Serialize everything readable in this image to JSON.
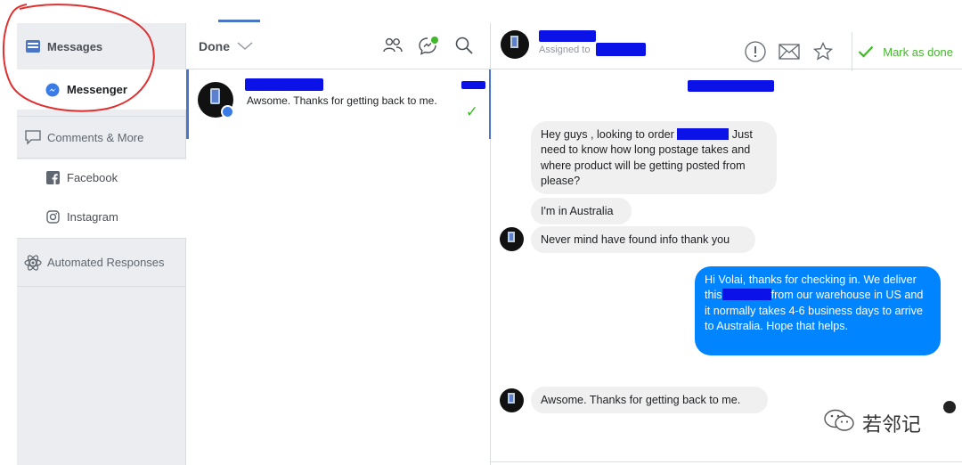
{
  "sidebar": {
    "messages": "Messages",
    "messenger": "Messenger",
    "comments": "Comments & More",
    "facebook": "Facebook",
    "instagram": "Instagram",
    "automated": "Automated Responses"
  },
  "list": {
    "filter_label": "Done",
    "rows": [
      {
        "snippet": "Awsome. Thanks for getting back to me."
      }
    ]
  },
  "chat": {
    "assigned_label": "Assigned to",
    "mark_done_label": "Mark as done",
    "messages": [
      {
        "side": "in",
        "text_a": "Hey guys , looking to order ",
        "text_b": " Just need to know how long postage takes and where product will be getting posted from please?"
      },
      {
        "side": "in",
        "text": "I'm in Australia"
      },
      {
        "side": "in",
        "text": "Never mind have found info thank you"
      },
      {
        "side": "out",
        "text_a": "Hi Volai, thanks for checking in. We deliver this",
        "text_b": "from our warehouse in US and it normally takes 4-6 business days to arrive to Australia. Hope that helps."
      },
      {
        "side": "in",
        "text": "Awsome. Thanks for getting back to me."
      }
    ]
  },
  "watermark": {
    "text": "若邻记"
  },
  "colors": {
    "accent": "#4a76c5",
    "outgoing": "#0084ff",
    "incoming": "#f1f0f0",
    "done_green": "#42b72a",
    "redaction": "#0a12e8"
  }
}
